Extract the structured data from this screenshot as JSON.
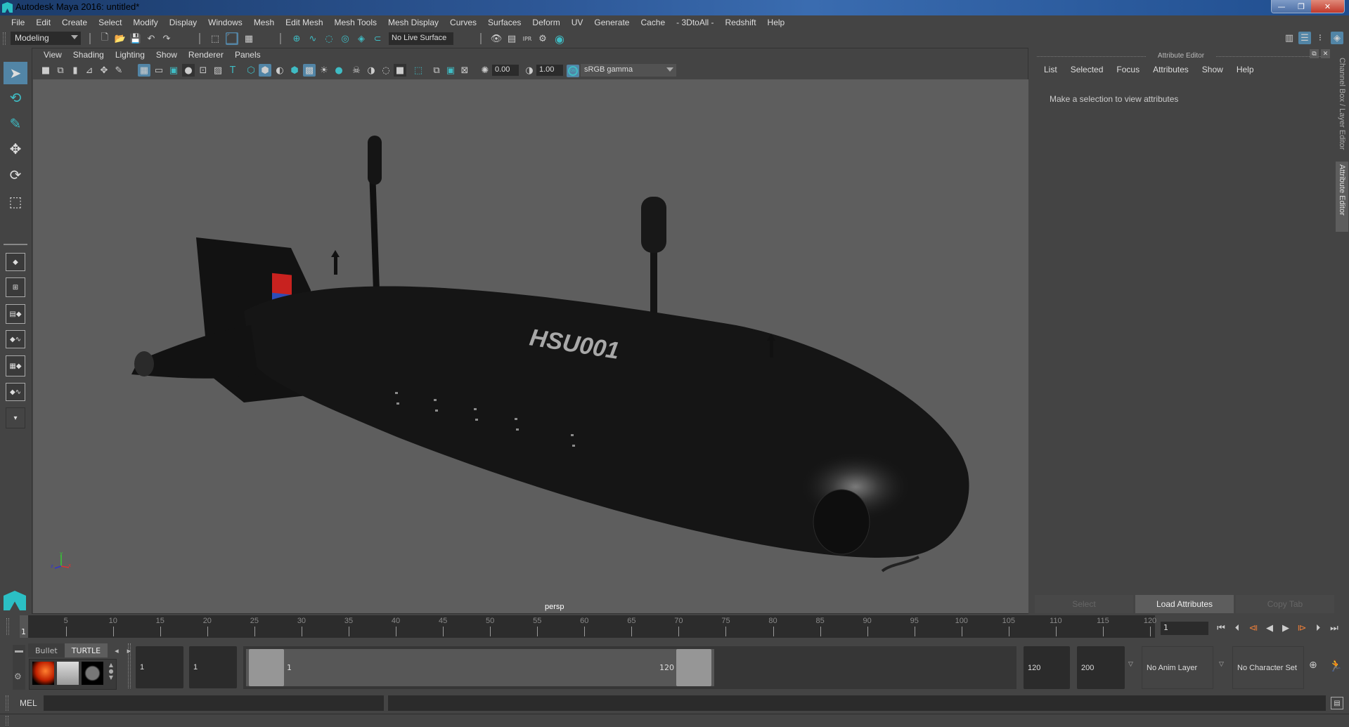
{
  "window": {
    "title": "Autodesk Maya 2016: untitled*",
    "controls": {
      "minimize": "—",
      "restore": "❐",
      "close": "✕"
    }
  },
  "menubar": [
    "File",
    "Edit",
    "Create",
    "Select",
    "Modify",
    "Display",
    "Windows",
    "Mesh",
    "Edit Mesh",
    "Mesh Tools",
    "Mesh Display",
    "Curves",
    "Surfaces",
    "Deform",
    "UV",
    "Generate",
    "Cache",
    "- 3DtoAll -",
    "Redshift",
    "Help"
  ],
  "status_line": {
    "menu_set": "Modeling",
    "live_surface": "No Live Surface",
    "icons": [
      "new-scene-icon",
      "open-scene-icon",
      "save-scene-icon",
      "undo-icon",
      "redo-icon",
      "select-by-hierarchy-icon",
      "select-by-object-icon",
      "select-by-component-icon",
      "snap-grid-icon",
      "snap-curve-icon",
      "snap-point-icon",
      "snap-view-plane-icon",
      "snap-live-icon",
      "render-view-icon",
      "render-current-icon",
      "ipr-render-icon",
      "render-settings-icon",
      "hypershade-icon"
    ],
    "right_icons": [
      "modeling-toolkit-icon",
      "attribute-editor-toggle-icon",
      "tool-settings-icon",
      "channel-box-icon"
    ]
  },
  "toolbox": {
    "tools": [
      "select-tool",
      "lasso-tool",
      "paint-select-tool",
      "move-tool",
      "rotate-tool",
      "scale-tool"
    ],
    "layouts": [
      "single-perspective-layout",
      "four-view-layout",
      "persp-outliner-layout",
      "persp-graph-layout",
      "hypershade-layout",
      "persp-uv-layout",
      "more-layouts"
    ]
  },
  "viewport": {
    "menu": [
      "View",
      "Shading",
      "Lighting",
      "Show",
      "Renderer",
      "Panels"
    ],
    "exposure": "0.00",
    "gamma": "1.00",
    "color_management": "ON",
    "view_transform": "sRGB gamma",
    "camera_label": "persp",
    "model_label": "HSU001",
    "axis": {
      "x": "x",
      "y": "y",
      "z": "z"
    }
  },
  "attribute_editor": {
    "header": "Attribute Editor",
    "menu": [
      "List",
      "Selected",
      "Focus",
      "Attributes",
      "Show",
      "Help"
    ],
    "message": "Make a selection to view attributes",
    "buttons": {
      "select": "Select",
      "load": "Load Attributes",
      "copy": "Copy Tab"
    }
  },
  "side_tabs": {
    "channel_box": "Channel Box / Layer Editor",
    "attribute_editor": "Attribute Editor"
  },
  "time_slider": {
    "ticks": [
      5,
      10,
      15,
      20,
      25,
      30,
      35,
      40,
      45,
      50,
      55,
      60,
      65,
      70,
      75,
      80,
      85,
      90,
      95,
      100,
      105,
      110,
      115,
      120
    ],
    "current_frame_marker": "1",
    "current_frame": "1",
    "min": 1,
    "max": 120
  },
  "playback": [
    "go-to-start-icon",
    "step-back-frame-icon",
    "step-back-key-icon",
    "play-backward-icon",
    "play-forward-icon",
    "step-forward-key-icon",
    "step-forward-frame-icon",
    "go-to-end-icon"
  ],
  "range_slider": {
    "shelf_tabs": [
      "Bullet",
      "TURTLE"
    ],
    "start_time": "1",
    "playback_start": "1",
    "range_start_label": "1",
    "range_end_label": "120",
    "playback_end": "120",
    "end_time": "200",
    "anim_layer": "No Anim Layer",
    "character_set": "No Character Set"
  },
  "command_line": {
    "label": "MEL",
    "value": ""
  }
}
